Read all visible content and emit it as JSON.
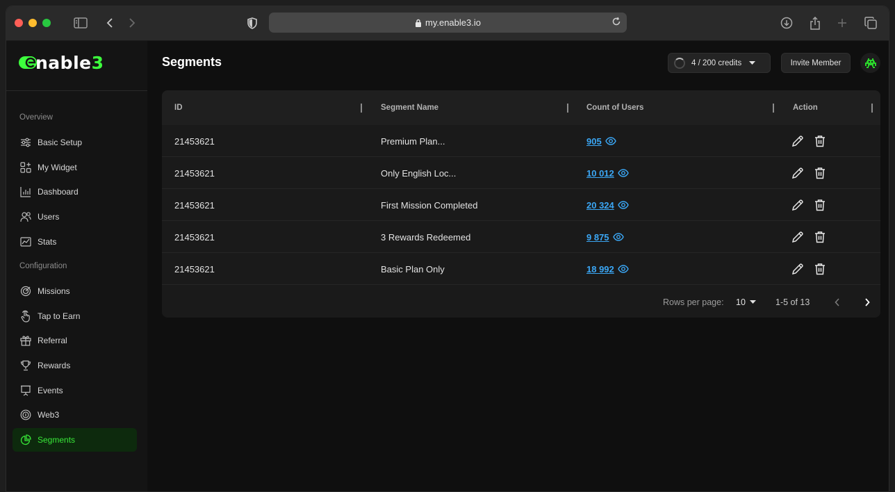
{
  "browser": {
    "url": "my.enable3.io",
    "icons": [
      "sidebar-toggle-icon",
      "back-icon",
      "forward-icon",
      "shield-icon",
      "lock-icon",
      "reload-icon",
      "download-icon",
      "share-icon",
      "new-tab-icon",
      "tabs-overview-icon"
    ]
  },
  "brand": {
    "logo_text": "nable",
    "logo_num": "3",
    "accent": "#3dff3d"
  },
  "sidebar": {
    "overview_label": "Overview",
    "overview_items": [
      {
        "label": "Basic Setup",
        "icon": "sliders-icon"
      },
      {
        "label": "My Widget",
        "icon": "widget-grid-icon"
      },
      {
        "label": "Dashboard",
        "icon": "bar-chart-icon"
      },
      {
        "label": "Users",
        "icon": "users-icon"
      },
      {
        "label": "Stats",
        "icon": "stats-icon"
      }
    ],
    "configuration_label": "Configuration",
    "configuration_items": [
      {
        "label": "Missions",
        "icon": "target-icon"
      },
      {
        "label": "Tap to Earn",
        "icon": "tap-hand-icon"
      },
      {
        "label": "Referral",
        "icon": "gift-icon"
      },
      {
        "label": "Rewards",
        "icon": "trophy-icon"
      },
      {
        "label": "Events",
        "icon": "presentation-icon"
      },
      {
        "label": "Web3",
        "icon": "coin-icon"
      },
      {
        "label": "Segments",
        "icon": "pie-chart-icon",
        "active": true
      }
    ]
  },
  "header": {
    "title": "Segments",
    "credits": "4 / 200 credits",
    "invite_label": "Invite Member",
    "avatar_icon": "alien-avatar-icon"
  },
  "table": {
    "columns": [
      "ID",
      "Segment Name",
      "Count of Users",
      "Action"
    ],
    "rows": [
      {
        "id": "21453621",
        "name": "Premium Plan...",
        "count": "905"
      },
      {
        "id": "21453621",
        "name": "Only English Loc...",
        "count": "10 012"
      },
      {
        "id": "21453621",
        "name": "First Mission Completed",
        "count": "20 324"
      },
      {
        "id": "21453621",
        "name": "3 Rewards Redeemed",
        "count": "9 875"
      },
      {
        "id": "21453621",
        "name": "Basic Plan Only",
        "count": "18 992"
      }
    ],
    "link_color": "#3ba7f5"
  },
  "pagination": {
    "rows_per_page_label": "Rows per page:",
    "rows_per_page_value": "10",
    "range": "1-5 of 13"
  }
}
